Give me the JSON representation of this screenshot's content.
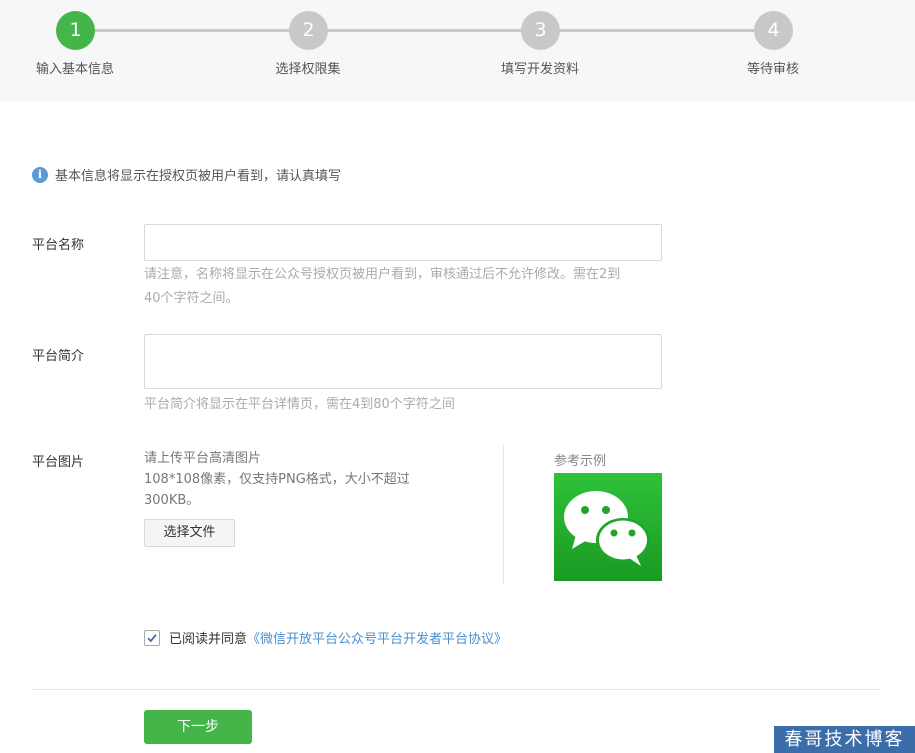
{
  "steps": [
    {
      "number": "1",
      "label": "输入基本信息",
      "active": true
    },
    {
      "number": "2",
      "label": "选择权限集",
      "active": false
    },
    {
      "number": "3",
      "label": "填写开发资料",
      "active": false
    },
    {
      "number": "4",
      "label": "等待审核",
      "active": false
    }
  ],
  "notice": {
    "icon": "info-icon",
    "icon_glyph": "i",
    "text": "基本信息将显示在授权页被用户看到，请认真填写"
  },
  "form": {
    "name": {
      "label": "平台名称",
      "value": "",
      "hint_line1": "请注意，名称将显示在公众号授权页被用户看到，审核通过后不允许修改。需在2到",
      "hint_line2": "40个字符之间。"
    },
    "intro": {
      "label": "平台简介",
      "value": "",
      "hint": "平台简介将显示在平台详情页，需在4到80个字符之间"
    },
    "image": {
      "label": "平台图片",
      "upload_line1": "请上传平台高清图片",
      "upload_line2": "108*108像素，仅支持PNG格式，大小不超过",
      "upload_line3": "300KB。",
      "file_button": "选择文件",
      "sample_label": "参考示例",
      "sample_icon": "wechat-logo-icon"
    }
  },
  "agreement": {
    "checked": true,
    "text": "已阅读并同意",
    "link": "《微信开放平台公众号平台开发者平台协议》"
  },
  "next_button": "下一步",
  "watermark": "春哥技术博客",
  "colors": {
    "accent": "#44b549",
    "inactive_step": "#c8c8c8",
    "link": "#4a8fd0",
    "info": "#5a9ad6"
  }
}
